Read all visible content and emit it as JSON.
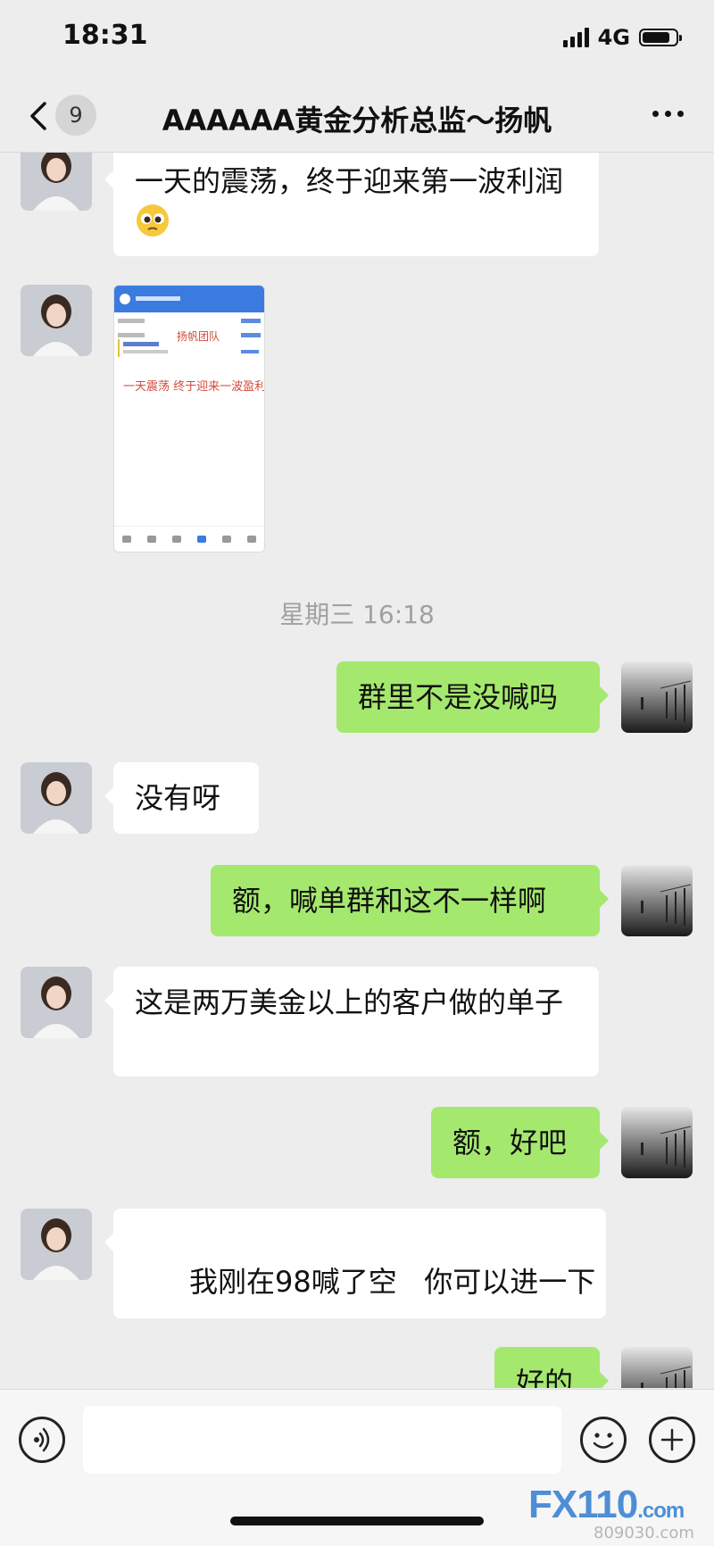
{
  "status_bar": {
    "time": "18:31",
    "network": "4G"
  },
  "nav": {
    "unread_count": "9",
    "title": "AAAAAA黄金分析总监～扬帆"
  },
  "messages": [
    {
      "side": "in",
      "text": "一天的震荡，终于迎来第一波利润",
      "emoji": "🥺"
    },
    {
      "side": "in",
      "type": "image",
      "image_label": "扬帆团队",
      "image_caption": "一天震荡 终于迎来一波盈利"
    },
    {
      "type": "time",
      "text": "星期三 16:18"
    },
    {
      "side": "out",
      "text": "群里不是没喊吗"
    },
    {
      "side": "in",
      "text": "没有呀"
    },
    {
      "side": "out",
      "text": "额，喊单群和这不一样啊"
    },
    {
      "side": "in",
      "text": "这是两万美金以上的客户做的单子"
    },
    {
      "side": "out",
      "text": "额，好吧"
    },
    {
      "side": "in",
      "text": "我刚在98喊了空   你可以进一下"
    },
    {
      "side": "out",
      "text": "好的"
    }
  ],
  "input_bar": {
    "placeholder": ""
  },
  "watermark": {
    "brand": "FX110",
    "suffix": ".com",
    "sub": "809030.com"
  }
}
